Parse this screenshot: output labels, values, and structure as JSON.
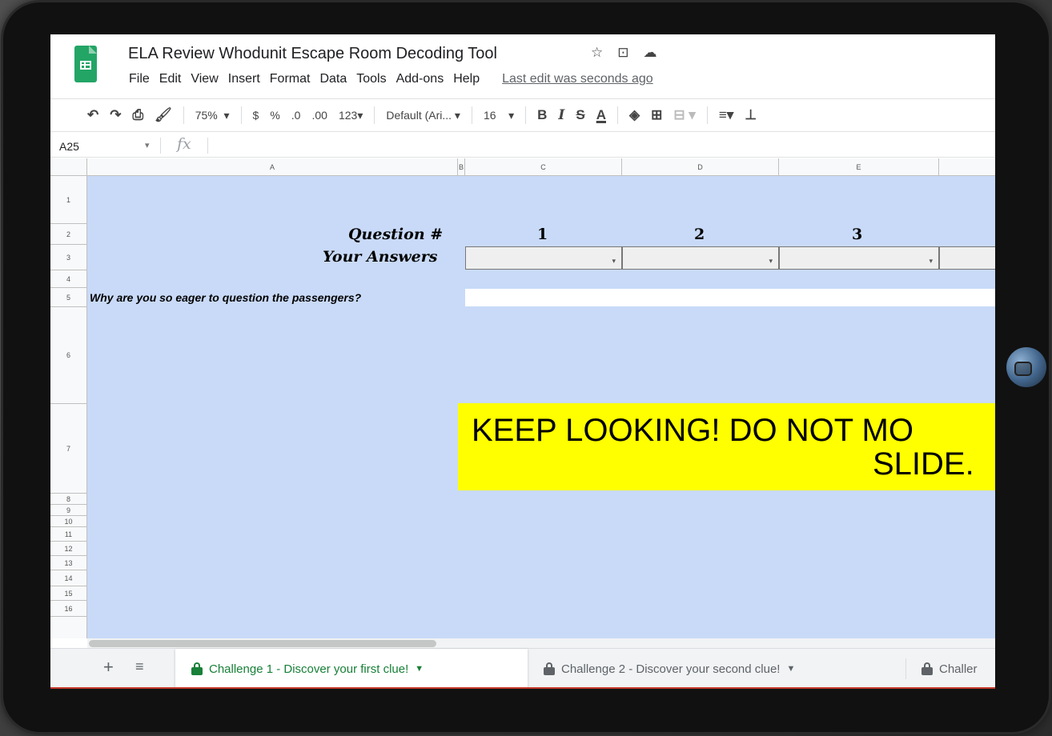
{
  "document": {
    "title": "ELA Review Whodunit Escape Room Decoding Tool",
    "icons": [
      "star-icon",
      "move-folder-icon",
      "cloud-saved-icon"
    ]
  },
  "menu": {
    "items": [
      "File",
      "Edit",
      "View",
      "Insert",
      "Format",
      "Data",
      "Tools",
      "Add-ons",
      "Help"
    ],
    "last_edit": "Last edit was seconds ago"
  },
  "toolbar": {
    "zoom": "75%",
    "currency": "$",
    "percent": "%",
    "decimal_decrease": ".0",
    "decimal_increase": ".00",
    "more_formats": "123",
    "font": "Default (Ari...",
    "font_size": "16",
    "bold": "B",
    "italic": "I",
    "strikethrough": "S",
    "text_color": "A"
  },
  "formula_bar": {
    "cell_ref": "A25",
    "fx": "fx"
  },
  "columns": [
    "A",
    "B",
    "C",
    "D",
    "E"
  ],
  "rows": [
    "1",
    "2",
    "3",
    "4",
    "5",
    "6",
    "7",
    "8",
    "9",
    "10",
    "11",
    "12",
    "13",
    "14",
    "15",
    "16"
  ],
  "sheet": {
    "question_label": "Question #",
    "answers_label": "Your Answers",
    "questions": [
      "1",
      "2",
      "3"
    ],
    "prompt": "Why are you so eager to question the passengers?",
    "banner_line1": "KEEP LOOKING! DO NOT MO",
    "banner_line2": "SLIDE.",
    "background_color": "#c9daf8",
    "banner_color": "#ffff00"
  },
  "tabs": {
    "add": "+",
    "list": "≡",
    "items": [
      {
        "label": "Challenge 1 - Discover your first clue!",
        "active": true
      },
      {
        "label": "Challenge 2 - Discover your second clue!",
        "active": false
      },
      {
        "label": "Challer",
        "active": false
      }
    ]
  }
}
